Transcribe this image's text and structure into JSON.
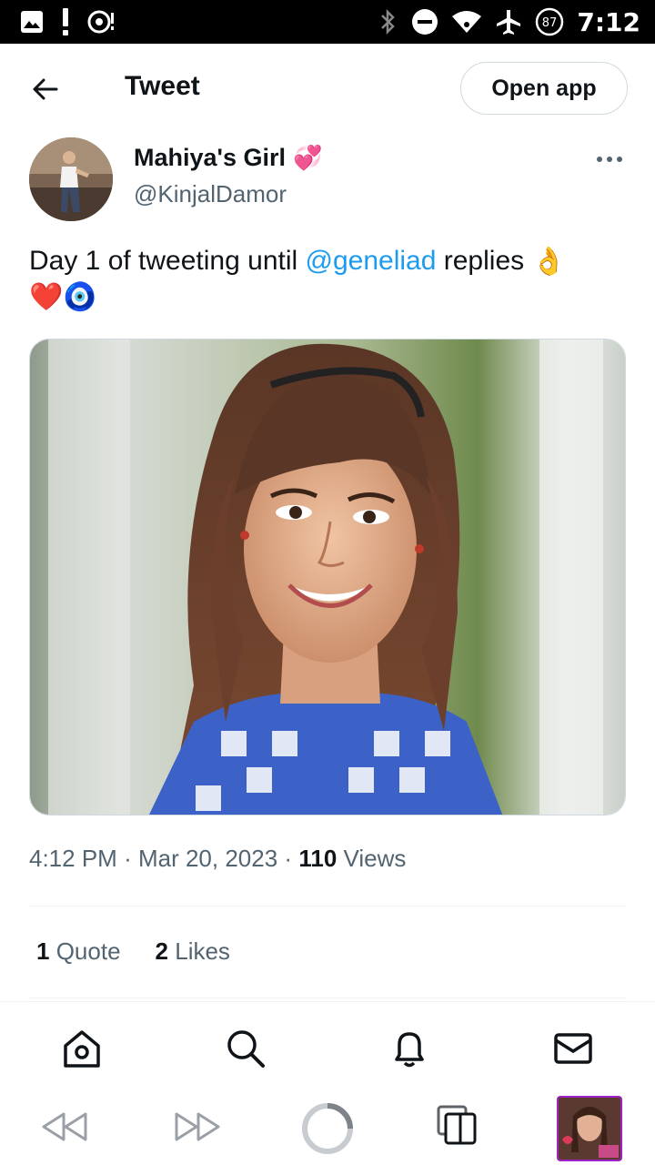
{
  "status_bar": {
    "time": "7:12",
    "battery": "87",
    "icons": [
      "image-icon",
      "alert-icon",
      "record-icon",
      "bluetooth-off-icon",
      "dnd-icon",
      "wifi-icon",
      "airplane-icon",
      "battery-icon"
    ]
  },
  "header": {
    "title": "Tweet",
    "open_app_label": "Open app"
  },
  "author": {
    "display_name": "Mahiya's Girl",
    "name_emoji": "💞",
    "handle": "@KinjalDamor"
  },
  "tweet": {
    "text_before": "Day 1 of tweeting until ",
    "mention": "@geneliad",
    "text_after": " replies ",
    "emoji_1": "👌",
    "emoji_2": "❤️",
    "emoji_3": "🧿"
  },
  "meta": {
    "time": "4:12 PM",
    "separator": "·",
    "date": "Mar 20, 2023",
    "views_count": "110",
    "views_label": "Views"
  },
  "stats": {
    "quote_count": "1",
    "quote_label": "Quote",
    "likes_count": "2",
    "likes_label": "Likes"
  },
  "tabs": [
    "home-icon",
    "search-icon",
    "notifications-icon",
    "messages-icon"
  ],
  "colors": {
    "accent": "#1d9bf0",
    "secondary_text": "#536471",
    "border": "#cfd9de"
  }
}
